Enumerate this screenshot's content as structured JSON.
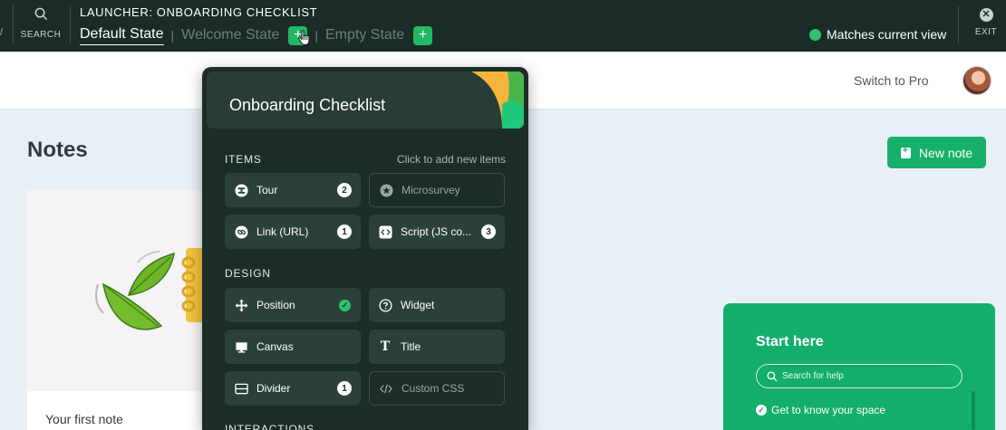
{
  "editor_bar": {
    "edge_glyph": "/",
    "search_label": "SEARCH",
    "title": "LAUNCHER: ONBOARDING CHECKLIST",
    "tabs": [
      {
        "label": "Default State",
        "active": true
      },
      {
        "label": "Welcome State",
        "active": false
      },
      {
        "label": "Empty State",
        "active": false
      }
    ],
    "plus_glyph": "+",
    "match_status": "Matches current view",
    "exit_label": "EXIT"
  },
  "app_header": {
    "switch_label": "Switch to Pro"
  },
  "page": {
    "title": "Notes",
    "new_note_label": "New note",
    "card_title": "Your first note"
  },
  "help_widget": {
    "title": "Start here",
    "search_placeholder": "Search for help",
    "items": [
      "Get to know your space"
    ]
  },
  "checklist_panel": {
    "title": "Onboarding Checklist",
    "sections": {
      "items": "ITEMS",
      "items_hint": "Click to add new items",
      "design": "DESIGN",
      "interactions": "INTERACTIONS"
    },
    "items": [
      {
        "label": "Tour",
        "count": "2",
        "icon": "tour-icon"
      },
      {
        "label": "Microsurvey",
        "icon": "microsurvey-icon"
      },
      {
        "label": "Link (URL)",
        "count": "1",
        "icon": "link-icon"
      },
      {
        "label": "Script (JS co...",
        "count": "3",
        "icon": "script-icon"
      }
    ],
    "design": [
      {
        "label": "Position",
        "checked": true,
        "icon": "move-icon"
      },
      {
        "label": "Widget",
        "icon": "question-icon"
      },
      {
        "label": "Canvas",
        "icon": "monitor-icon"
      },
      {
        "label": "Title",
        "icon": "title-icon"
      },
      {
        "label": "Divider",
        "count": "1",
        "icon": "divider-icon"
      },
      {
        "label": "Custom CSS",
        "icon": "code-icon"
      }
    ]
  },
  "colors": {
    "editor_bg": "#1b2c28",
    "accent_green": "#17b06b",
    "panel_bg": "#1c2d28",
    "page_bg": "#e8f0f6"
  }
}
